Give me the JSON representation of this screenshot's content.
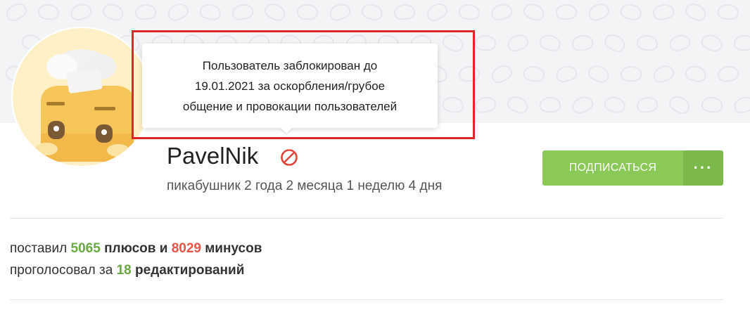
{
  "tooltip": {
    "line1": "Пользователь заблокирован до",
    "line2": "19.01.2021 за оскорбления/грубое",
    "line3": "общение и провокации пользователей"
  },
  "profile": {
    "username": "PavelNik",
    "tenure": "пикабушник 2 года 2 месяца 1 неделю 4 дня",
    "ban_icon": "ban-icon",
    "avatar": "chef-toast-avatar"
  },
  "actions": {
    "subscribe_label": "ПОДПИСАТЬСЯ",
    "more_label": "···"
  },
  "stats": {
    "votes_prefix": "поставил",
    "plus_count": "5065",
    "plus_label": "плюсов и",
    "minus_count": "8029",
    "minus_label": "минусов",
    "edits_prefix": "проголосовал за",
    "edits_count": "18",
    "edits_label": "редактирований"
  },
  "colors": {
    "accent_green": "#8ac858",
    "plus_green": "#6aa842",
    "minus_red": "#e8544a",
    "highlight_red": "#e0252b"
  }
}
